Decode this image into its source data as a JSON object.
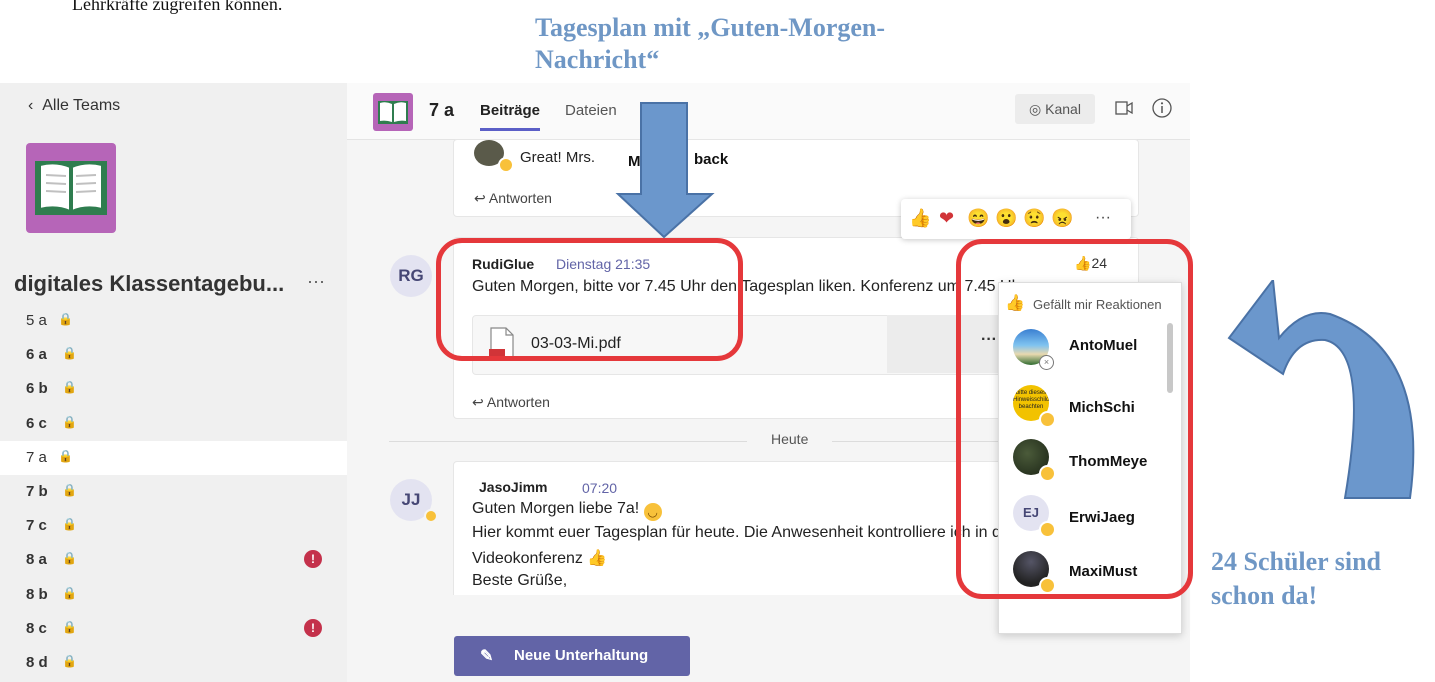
{
  "doc": {
    "top_text": "Lehrkräfte zugreifen können.",
    "annotation_top": "Tagesplan mit „Guten-Morgen-Nachricht“",
    "annotation_right": "24 Schüler sind schon da!"
  },
  "sidebar": {
    "back_label": "Alle Teams",
    "team_name": "digitales Klassentagebu...",
    "more": "···",
    "channels": [
      {
        "label": "5 a",
        "bold": false,
        "badge": ""
      },
      {
        "label": "6 a",
        "bold": true,
        "badge": ""
      },
      {
        "label": "6 b",
        "bold": true,
        "badge": ""
      },
      {
        "label": "6 c",
        "bold": true,
        "badge": ""
      },
      {
        "label": "7 a",
        "bold": false,
        "badge": "",
        "selected": true
      },
      {
        "label": "7 b",
        "bold": true,
        "badge": ""
      },
      {
        "label": "7 c",
        "bold": true,
        "badge": ""
      },
      {
        "label": "8 a",
        "bold": true,
        "badge": "!"
      },
      {
        "label": "8 b",
        "bold": true,
        "badge": ""
      },
      {
        "label": "8 c",
        "bold": true,
        "badge": "!"
      },
      {
        "label": "8 d",
        "bold": true,
        "badge": ""
      }
    ]
  },
  "header": {
    "channel_name": "7 a",
    "tabs": [
      "Beiträge",
      "Dateien"
    ],
    "plus": "+",
    "kanal_label": "Kanal"
  },
  "messages": {
    "prev": {
      "text": "Great! Mrs.",
      "overlay": "M",
      "overlay2": "back",
      "reply": "Antworten"
    },
    "rudi": {
      "initials": "RG",
      "author": "RudiGlue",
      "time": "Dienstag 21:35",
      "text": "Guten Morgen, bitte vor 7.45 Uhr den Tagesplan liken. Konferenz um 7.45 Uhr.",
      "file": "03-03-Mi.pdf",
      "file_more": "···",
      "reply": "Antworten",
      "like_count": "24"
    },
    "divider": "Heute",
    "jaso": {
      "initials": "JJ",
      "author": "JasoJimm",
      "time": "07:20",
      "line1": "Guten Morgen liebe 7a!",
      "line2": "Hier kommt euer Tagesplan für heute. Die Anwesenheit kontrolliere ich in der",
      "line3": "Videokonferenz",
      "line4": "Beste Grüße,"
    }
  },
  "reactions_bar": [
    "👍",
    "❤",
    "😄",
    "😮",
    "😟",
    "😠",
    "···"
  ],
  "popup": {
    "title": "Gefällt mir Reaktionen",
    "users": [
      "AntoMuel",
      "MichSchi",
      "ThomMeye",
      "ErwiJaeg",
      "MaxiMust"
    ],
    "ej_initials": "EJ",
    "mich_sign": "bitte dieses Hinweisschild beachten"
  },
  "new_conversation": "Neue Unterhaltung",
  "colors": {
    "accent": "#6264a7",
    "team_tile": "#b665b8",
    "annotation": "#6f97c5",
    "highlight": "#e5383b",
    "arrow": "#6b97cc"
  }
}
